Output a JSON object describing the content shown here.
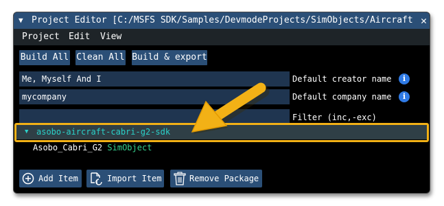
{
  "window": {
    "title": "Project Editor [C:/MSFS SDK/Samples/DevmodeProjects/SimObjects/Aircraft/Cabri",
    "collapse_icon": "triangle-down",
    "close_icon": "close-x"
  },
  "menu": {
    "items": [
      "Project",
      "Edit",
      "View"
    ]
  },
  "toolbar": {
    "build_all": "Build All",
    "clean_all": "Clean All",
    "build_export": "Build & export"
  },
  "fields": {
    "creator": {
      "value": "Me, Myself And I",
      "label": "Default creator name"
    },
    "company": {
      "value": "mycompany",
      "label": "Default company name"
    },
    "filter": {
      "value": "",
      "label": "Filter (inc,-exc)"
    }
  },
  "tree": {
    "package": {
      "expand_icon": "triangle-down",
      "name": "asobo-aircraft-cabri-g2-sdk"
    },
    "item": {
      "name": "Asobo_Cabri_G2",
      "type": "SimObject"
    }
  },
  "bottom": {
    "add_item": "Add Item",
    "import_item": "Import Item",
    "remove_package": "Remove Package"
  },
  "colors": {
    "title_bg": "#2b4f77",
    "accent_highlight": "#f2b116",
    "package_text": "#2bd1c9",
    "simobject_tag": "#35d08d",
    "info_icon": "#2f7ae5"
  }
}
